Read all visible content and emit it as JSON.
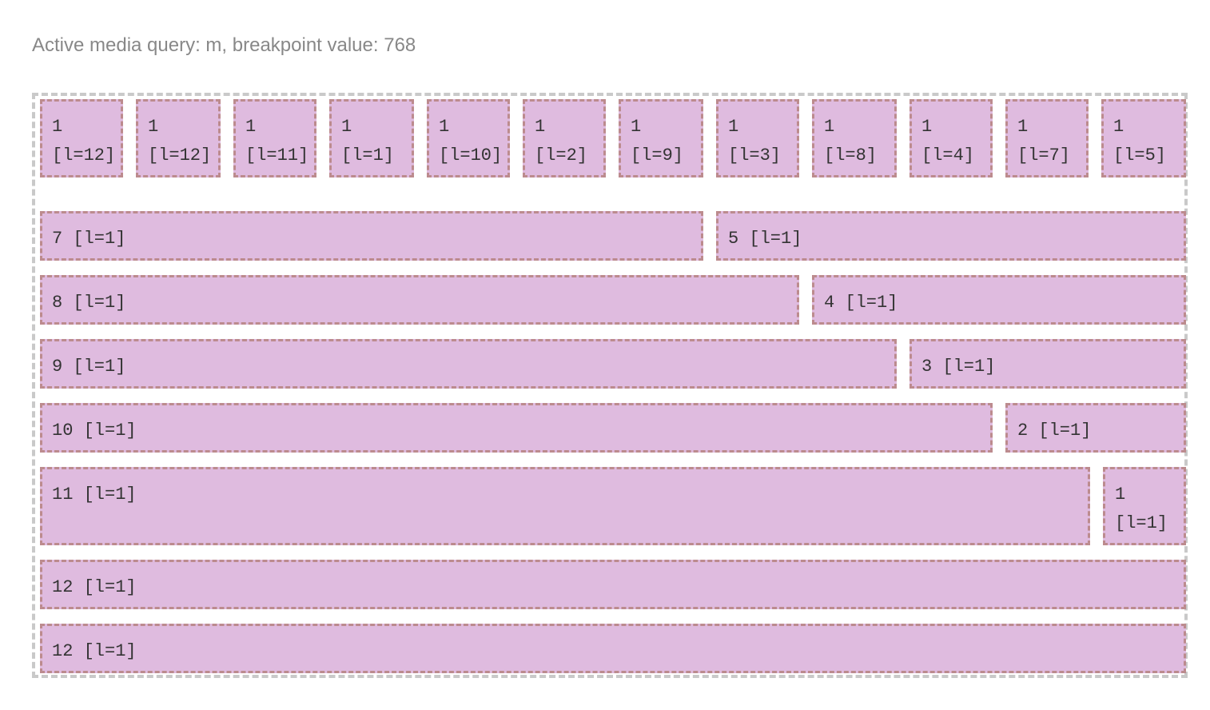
{
  "header": {
    "status_text": "Active media query: m, breakpoint value: 768"
  },
  "grid": {
    "rows": [
      {
        "cells": [
          {
            "num": "1",
            "label": "[l=12]"
          },
          {
            "num": "1",
            "label": "[l=12]"
          },
          {
            "num": "1",
            "label": "[l=11]"
          },
          {
            "num": "1",
            "label": "[l=1]"
          },
          {
            "num": "1",
            "label": "[l=10]"
          },
          {
            "num": "1",
            "label": "[l=2]"
          },
          {
            "num": "1",
            "label": "[l=9]"
          },
          {
            "num": "1",
            "label": "[l=3]"
          },
          {
            "num": "1",
            "label": "[l=8]"
          },
          {
            "num": "1",
            "label": "[l=4]"
          },
          {
            "num": "1",
            "label": "[l=7]"
          },
          {
            "num": "1",
            "label": "[l=5]"
          }
        ]
      },
      {
        "cells": [
          {
            "num": "7",
            "label": "[l=1]"
          },
          {
            "num": "5",
            "label": "[l=1]"
          }
        ]
      },
      {
        "cells": [
          {
            "num": "8",
            "label": "[l=1]"
          },
          {
            "num": "4",
            "label": "[l=1]"
          }
        ]
      },
      {
        "cells": [
          {
            "num": "9",
            "label": "[l=1]"
          },
          {
            "num": "3",
            "label": "[l=1]"
          }
        ]
      },
      {
        "cells": [
          {
            "num": "10",
            "label": "[l=1]"
          },
          {
            "num": "2",
            "label": "[l=1]"
          }
        ]
      },
      {
        "cells": [
          {
            "num": "11",
            "label": "[l=1]"
          },
          {
            "num": "1",
            "label": "[l=1]"
          }
        ]
      },
      {
        "cells": [
          {
            "num": "12",
            "label": "[l=1]"
          }
        ]
      },
      {
        "cells": [
          {
            "num": "12",
            "label": "[l=1]"
          }
        ]
      }
    ]
  }
}
